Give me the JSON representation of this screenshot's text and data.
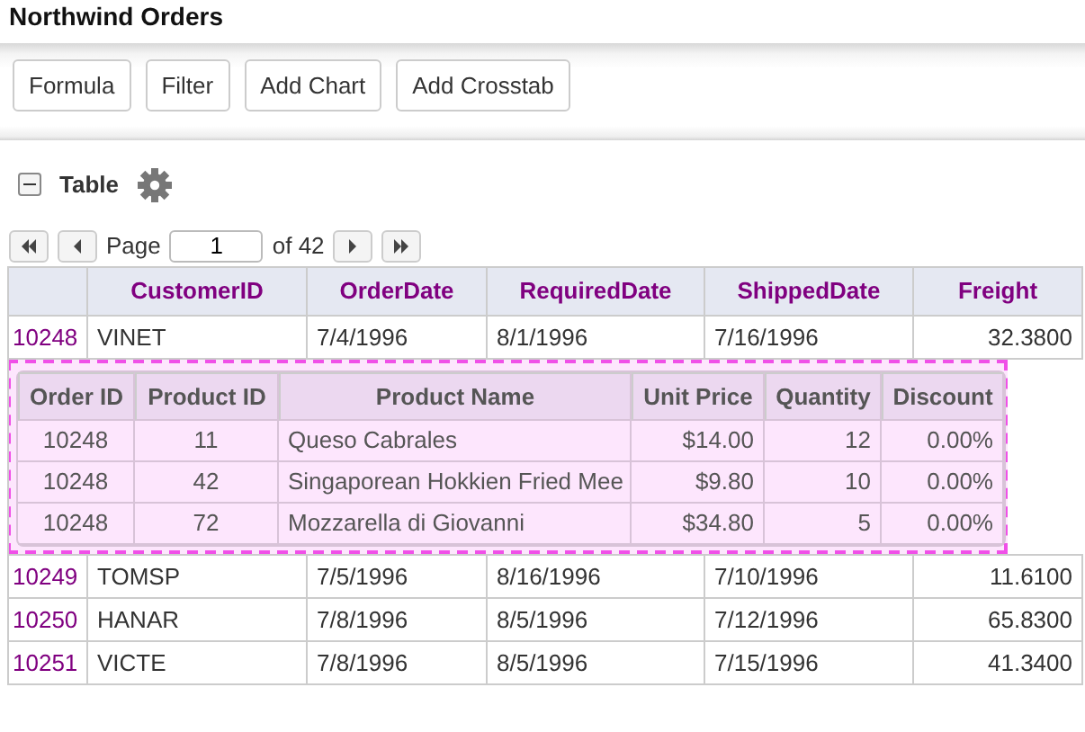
{
  "window": {
    "title": "Northwind Orders"
  },
  "toolbar": {
    "buttons": [
      "Formula",
      "Filter",
      "Add Chart",
      "Add Crosstab"
    ]
  },
  "section": {
    "title": "Table",
    "expanded": true
  },
  "pager": {
    "label": "Page",
    "page": "1",
    "of": "of 42"
  },
  "table": {
    "columns": [
      "",
      "CustomerID",
      "OrderDate",
      "RequiredDate",
      "ShippedDate",
      "Freight"
    ],
    "rows": [
      {
        "cells": [
          "10248",
          "VINET",
          "7/4/1996",
          "8/1/1996",
          "7/16/1996",
          "32.3800"
        ],
        "details": {
          "columns": [
            "Order ID",
            "Product ID",
            "Product Name",
            "Unit Price",
            "Quantity",
            "Discount"
          ],
          "rows": [
            [
              "10248",
              "11",
              "Queso Cabrales",
              "$14.00",
              "12",
              "0.00%"
            ],
            [
              "10248",
              "42",
              "Singaporean Hokkien Fried Mee",
              "$9.80",
              "10",
              "0.00%"
            ],
            [
              "10248",
              "72",
              "Mozzarella di Giovanni",
              "$34.80",
              "5",
              "0.00%"
            ]
          ]
        }
      },
      {
        "cells": [
          "10249",
          "TOMSP",
          "7/5/1996",
          "8/16/1996",
          "7/10/1996",
          "11.6100"
        ]
      },
      {
        "cells": [
          "10250",
          "HANAR",
          "7/8/1996",
          "8/5/1996",
          "7/12/1996",
          "65.8300"
        ]
      },
      {
        "cells": [
          "10251",
          "VICTE",
          "7/8/1996",
          "8/5/1996",
          "7/15/1996",
          "41.3400"
        ]
      }
    ]
  }
}
